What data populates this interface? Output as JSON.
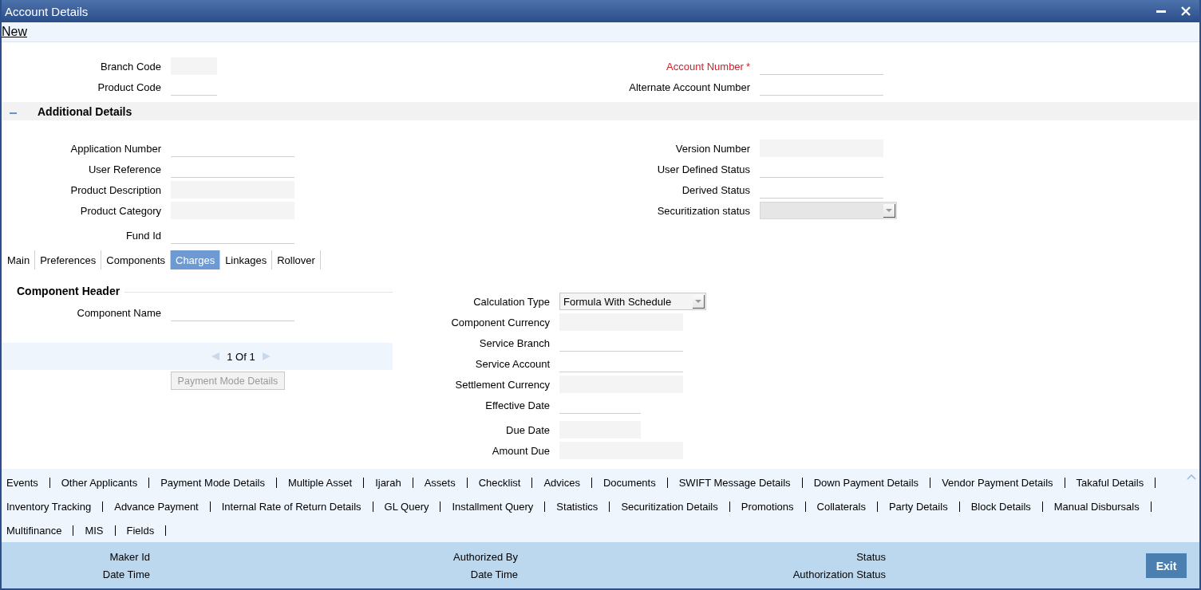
{
  "window": {
    "title": "Account Details"
  },
  "toolbar": [
    {
      "label": "New"
    }
  ],
  "header_fields": {
    "left": [
      {
        "label": "Branch Code",
        "kind": "readonly"
      },
      {
        "label": "Product Code",
        "kind": "text"
      }
    ],
    "right": [
      {
        "label": "Account Number",
        "kind": "text",
        "required": true,
        "required_mark": "*"
      },
      {
        "label": "Alternate Account Number",
        "kind": "text"
      }
    ]
  },
  "additional_details": {
    "title": "Additional Details",
    "expanded": true,
    "left": [
      {
        "label": "Application Number",
        "kind": "text"
      },
      {
        "label": "User Reference",
        "kind": "text"
      },
      {
        "label": "Product Description",
        "kind": "readonly"
      },
      {
        "label": "Product Category",
        "kind": "readonly"
      },
      {
        "label": "Fund Id",
        "kind": "text"
      }
    ],
    "right": [
      {
        "label": "Version Number",
        "kind": "readonly"
      },
      {
        "label": "User Defined Status",
        "kind": "text"
      },
      {
        "label": "Derived Status",
        "kind": "text"
      },
      {
        "label": "Securitization status",
        "kind": "select",
        "disabled": true
      }
    ]
  },
  "tabs": [
    {
      "label": "Main",
      "selected": false
    },
    {
      "label": "Preferences",
      "selected": false
    },
    {
      "label": "Components",
      "selected": false
    },
    {
      "label": "Charges",
      "selected": true
    },
    {
      "label": "Linkages",
      "selected": false
    },
    {
      "label": "Rollover",
      "selected": false
    }
  ],
  "component_header": {
    "title": "Component Header",
    "fields": [
      {
        "label": "Component Name",
        "kind": "text"
      }
    ],
    "pager": {
      "text": "1 Of 1"
    },
    "button": {
      "label": "Payment Mode Details",
      "disabled": true
    }
  },
  "charge_fields": [
    {
      "label": "Calculation Type",
      "kind": "select",
      "value": "Formula With Schedule"
    },
    {
      "label": "Component Currency",
      "kind": "readonly"
    },
    {
      "label": "Service Branch",
      "kind": "text"
    },
    {
      "label": "Service Account",
      "kind": "text"
    },
    {
      "label": "Settlement Currency",
      "kind": "readonly"
    },
    {
      "label": "Effective Date",
      "kind": "text"
    },
    {
      "label": "Due Date",
      "kind": "readonly"
    },
    {
      "label": "Amount Due",
      "kind": "readonly"
    }
  ],
  "links": [
    "Events",
    "Other Applicants",
    "Payment Mode Details",
    "Multiple Asset",
    "Ijarah",
    "Assets",
    "Checklist",
    "Advices",
    "Documents",
    "SWIFT Message Details",
    "Down Payment Details",
    "Vendor Payment Details",
    "Takaful Details",
    "Inventory Tracking",
    "Advance Payment",
    "Internal Rate of Return Details",
    "GL Query",
    "Installment Query",
    "Statistics",
    "Securitization Details",
    "Promotions",
    "Collaterals",
    "Party Details",
    "Block Details",
    "Manual Disbursals",
    "Multifinance",
    "MIS",
    "Fields"
  ],
  "audit": [
    {
      "label": "Maker Id"
    },
    {
      "label": "Authorized By"
    },
    {
      "label": "Status"
    },
    {
      "label": "Date Time"
    },
    {
      "label": "Date Time"
    },
    {
      "label": "Authorization Status"
    }
  ],
  "exit_button": {
    "label": "Exit"
  }
}
